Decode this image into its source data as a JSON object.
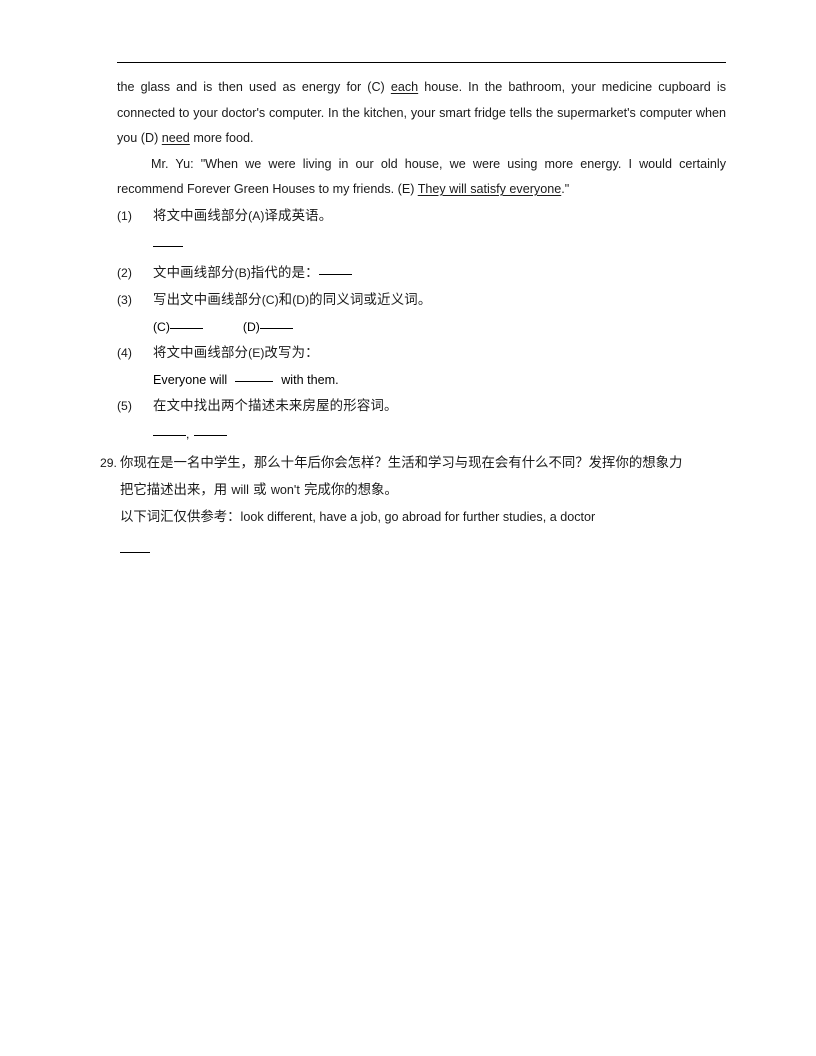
{
  "document": {
    "passage": {
      "line1_pre": "the glass and is then used as energy for (C) ",
      "line1_underline": "each",
      "line1_post": " house. In the bathroom, your medicine cupboard is connected to your doctor's computer. In the kitchen, your smart fridge tells the supermarket's computer when you (D) ",
      "line1_underline2": "need",
      "line1_end": " more food.",
      "quote_pre": "Mr. Yu: \"When we were living in our old house, we were using more energy. I would certainly recommend Forever Green Houses to my friends. (E) ",
      "quote_underline": "They will satisfy everyone",
      "quote_end": ".\""
    },
    "questions": [
      {
        "number": "(1)",
        "text_before": "将文中画线部分",
        "tag": "(A)",
        "text_after": "译成英语。",
        "answer_blank": true
      },
      {
        "number": "(2)",
        "text_before": "文中画线部分",
        "tag": "(B)",
        "text_after": "指代的是：",
        "inline_blank": true
      },
      {
        "number": "(3)",
        "text_before": "写出文中画线部分",
        "tag": "(C)",
        "text_mid": "和",
        "tag2": "(D)",
        "text_after": "的同义词或近义词。",
        "sub_labels": [
          "(C)",
          "(D)"
        ]
      },
      {
        "number": "(4)",
        "text_before": "将文中画线部分",
        "tag": "(E)",
        "text_after": "改写为：",
        "rewrite_pre": "Everyone will",
        "rewrite_post": "with them."
      },
      {
        "number": "(5)",
        "text_before": "在文中找出两个描述未来房屋的形容词。",
        "double_blank": true,
        "separator": ","
      }
    ],
    "big_question": {
      "number": "29.",
      "line1": "你现在是一名中学生，那么十年后你会怎样？生活和学习与现在会有什么不同？发挥你的想象力",
      "line2_pre": "把它描述出来，用",
      "line2_word1": "will",
      "line2_mid": "或",
      "line2_word2": "won't",
      "line2_post": "完成你的想象。",
      "line3_pre": "以下词汇仅供参考：",
      "line3_words": "look different, have a job, go abroad for further studies, a doctor"
    }
  }
}
